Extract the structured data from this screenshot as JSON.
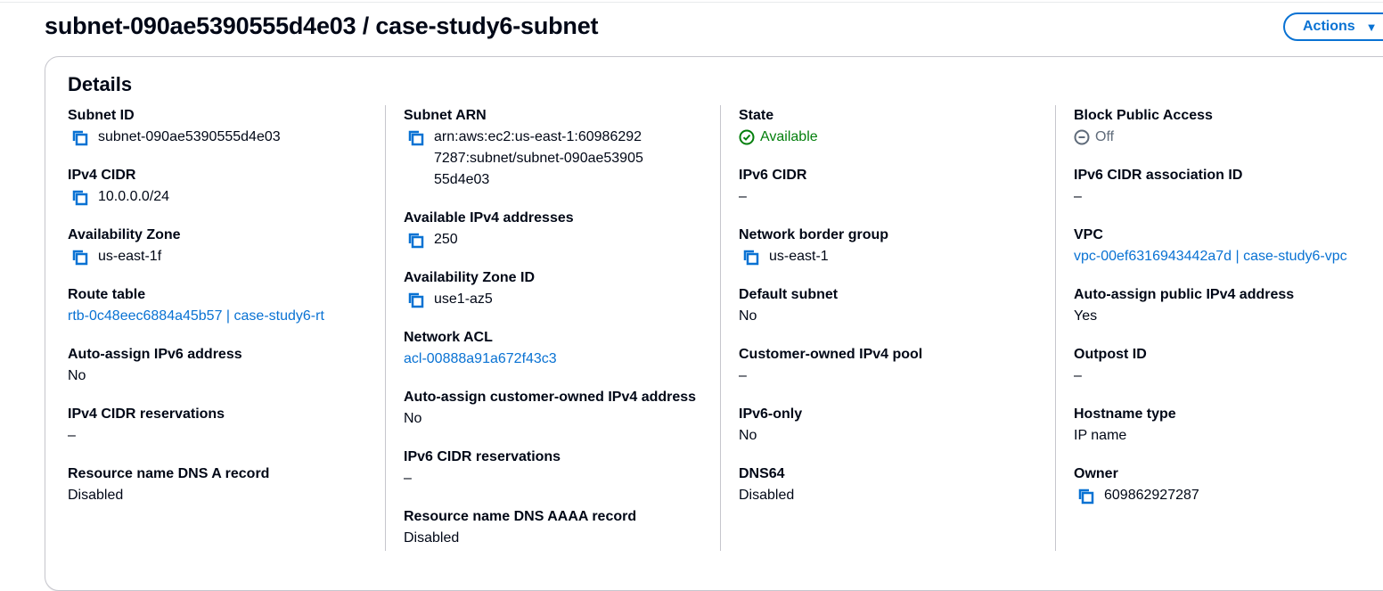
{
  "header": {
    "title": "subnet-090ae5390555d4e03 / case-study6-subnet",
    "actions_label": "Actions",
    "actions_caret": "▼"
  },
  "details": {
    "title": "Details",
    "col1": {
      "subnet_id": {
        "label": "Subnet ID",
        "value": "subnet-090ae5390555d4e03"
      },
      "ipv4_cidr": {
        "label": "IPv4 CIDR",
        "value": "10.0.0.0/24"
      },
      "az": {
        "label": "Availability Zone",
        "value": "us-east-1f"
      },
      "route_table": {
        "label": "Route table",
        "value": "rtb-0c48eec6884a45b57 | case-study6-rt"
      },
      "auto_ipv6": {
        "label": "Auto-assign IPv6 address",
        "value": "No"
      },
      "ipv4_res": {
        "label": "IPv4 CIDR reservations",
        "value": "–"
      },
      "dns_a": {
        "label": "Resource name DNS A record",
        "value": "Disabled"
      }
    },
    "col2": {
      "subnet_arn": {
        "label": "Subnet ARN",
        "value": "arn:aws:ec2:us-east-1:609862927287:subnet/subnet-090ae5390555d4e03"
      },
      "avail_ipv4": {
        "label": "Available IPv4 addresses",
        "value": "250"
      },
      "az_id": {
        "label": "Availability Zone ID",
        "value": "use1-az5"
      },
      "nacl": {
        "label": "Network ACL",
        "value": "acl-00888a91a672f43c3"
      },
      "auto_coip": {
        "label": "Auto-assign customer-owned IPv4 address",
        "value": "No"
      },
      "ipv6_res": {
        "label": "IPv6 CIDR reservations",
        "value": "–"
      },
      "dns_aaaa": {
        "label": "Resource name DNS AAAA record",
        "value": "Disabled"
      }
    },
    "col3": {
      "state": {
        "label": "State",
        "value": "Available"
      },
      "ipv6_cidr": {
        "label": "IPv6 CIDR",
        "value": "–"
      },
      "nbg": {
        "label": "Network border group",
        "value": "us-east-1"
      },
      "default_subnet": {
        "label": "Default subnet",
        "value": "No"
      },
      "coip_pool": {
        "label": "Customer-owned IPv4 pool",
        "value": "–"
      },
      "ipv6_only": {
        "label": "IPv6-only",
        "value": "No"
      },
      "dns64": {
        "label": "DNS64",
        "value": "Disabled"
      }
    },
    "col4": {
      "bpa": {
        "label": "Block Public Access",
        "value": "Off"
      },
      "ipv6_assoc": {
        "label": "IPv6 CIDR association ID",
        "value": "–"
      },
      "vpc": {
        "label": "VPC",
        "value": "vpc-00ef6316943442a7d | case-study6-vpc"
      },
      "auto_pub_ipv4": {
        "label": "Auto-assign public IPv4 address",
        "value": "Yes"
      },
      "outpost": {
        "label": "Outpost ID",
        "value": "–"
      },
      "hostname": {
        "label": "Hostname type",
        "value": "IP name"
      },
      "owner": {
        "label": "Owner",
        "value": "609862927287"
      }
    }
  },
  "colors": {
    "link": "#0972d3",
    "success": "#037f0c",
    "muted": "#5f6b7a",
    "text": "#000716",
    "border": "#c6c6cd"
  },
  "icons": {
    "copy": "copy-icon",
    "status_available": "check-circle-icon",
    "status_off": "minus-circle-icon",
    "dropdown": "caret-down-icon"
  }
}
